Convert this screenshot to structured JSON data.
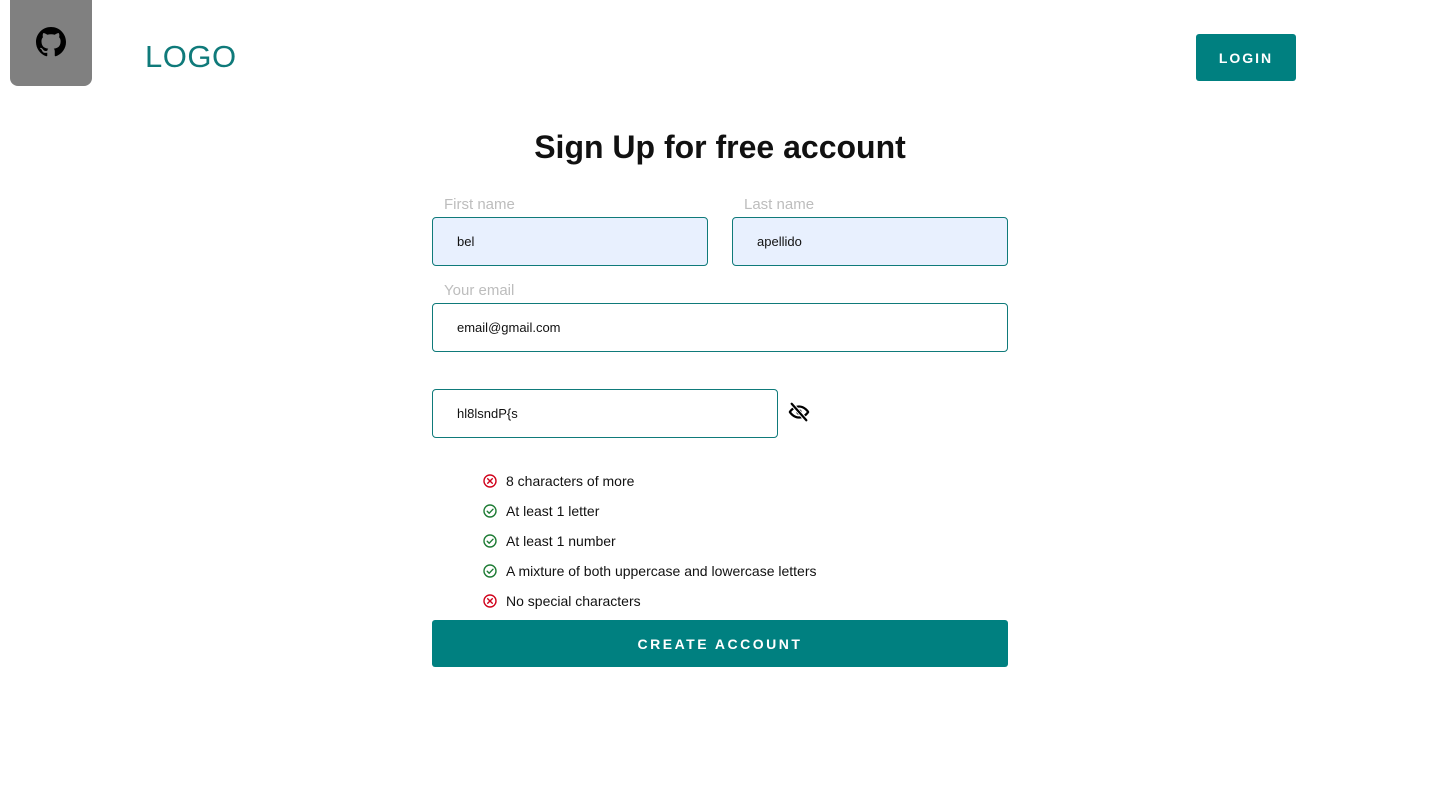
{
  "header": {
    "github_icon": "github-icon",
    "logo_text": "LOGO",
    "login_label": "LOGIN"
  },
  "form": {
    "title": "Sign Up for free account",
    "first_name": {
      "label": "First name",
      "value": "bel"
    },
    "last_name": {
      "label": "Last name",
      "value": "apellido"
    },
    "email": {
      "label": "Your email",
      "value": "email@gmail.com"
    },
    "password": {
      "value": "hl8lsndP{s",
      "visibility_icon": "eye-off-icon"
    },
    "rules": [
      {
        "text": "8 characters of more",
        "status": "fail"
      },
      {
        "text": "At least 1 letter",
        "status": "pass"
      },
      {
        "text": "At least 1 number",
        "status": "pass"
      },
      {
        "text": "A mixture of both uppercase and lowercase letters",
        "status": "pass"
      },
      {
        "text": "No special characters",
        "status": "fail"
      }
    ],
    "submit_label": "CREATE ACCOUNT"
  },
  "colors": {
    "accent": "#008080",
    "logo": "#0f7a7a",
    "pass": "#1e7b34",
    "fail": "#d0021b",
    "autofill_bg": "#e8f0fe",
    "label": "#bdbdbd"
  }
}
